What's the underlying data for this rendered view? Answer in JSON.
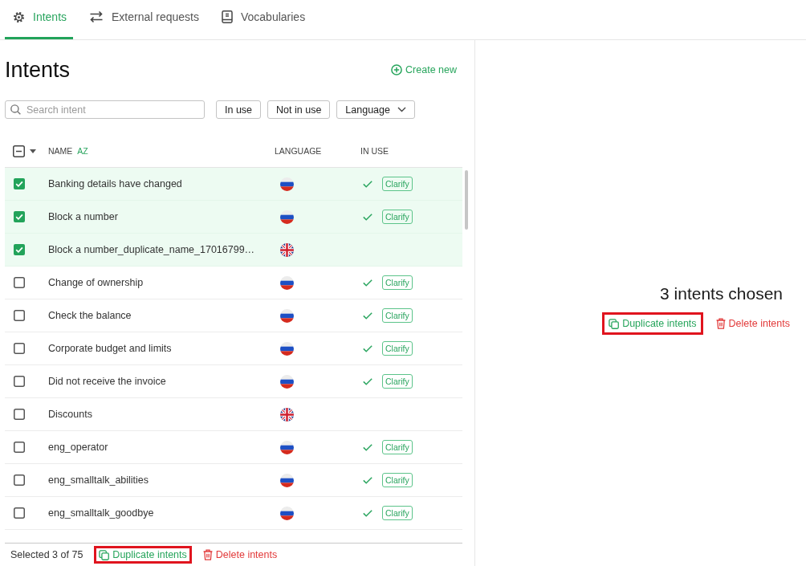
{
  "tabs": [
    {
      "label": "Intents",
      "kind": "gear",
      "selected": true
    },
    {
      "label": "External requests",
      "kind": "swap",
      "selected": false
    },
    {
      "label": "Vocabularies",
      "kind": "book",
      "selected": false
    }
  ],
  "list_panel": {
    "title": "Intents",
    "create_link": "Create new",
    "search": {
      "placeholder": "Search intent"
    },
    "filters": [
      {
        "label": "In use",
        "kind": "toggle"
      },
      {
        "label": "Not in use",
        "kind": "toggle"
      },
      {
        "label": "Language",
        "kind": "dropdown"
      }
    ]
  },
  "table": {
    "select_all": {
      "indeterminate": true
    },
    "columns": [
      {
        "label": "NAME",
        "sort": "AZ"
      },
      {
        "label": "LANGUAGE"
      },
      {
        "label": "IN USE"
      }
    ],
    "rows": [
      {
        "name": "Banking details have changed",
        "checked": true,
        "flag": {
          "kind": "ru"
        },
        "in_use": true,
        "badge": "Clarify"
      },
      {
        "name": "Block a number",
        "checked": true,
        "flag": {
          "kind": "ru"
        },
        "in_use": true,
        "badge": "Clarify"
      },
      {
        "name": "Block a number_duplicate_name_17016799…",
        "checked": true,
        "flag": {
          "kind": "gb"
        },
        "in_use": false
      },
      {
        "name": "Change of ownership",
        "checked": false,
        "flag": {
          "kind": "ru"
        },
        "in_use": true,
        "badge": "Clarify"
      },
      {
        "name": "Check the balance",
        "checked": false,
        "flag": {
          "kind": "ru"
        },
        "in_use": true,
        "badge": "Clarify"
      },
      {
        "name": "Corporate budget and limits",
        "checked": false,
        "flag": {
          "kind": "ru"
        },
        "in_use": true,
        "badge": "Clarify"
      },
      {
        "name": "Did not receive the invoice",
        "checked": false,
        "flag": {
          "kind": "ru"
        },
        "in_use": true,
        "badge": "Clarify"
      },
      {
        "name": "Discounts",
        "checked": false,
        "flag": {
          "kind": "gb"
        },
        "in_use": false
      },
      {
        "name": "eng_operator",
        "checked": false,
        "flag": {
          "kind": "ru"
        },
        "in_use": true,
        "badge": "Clarify"
      },
      {
        "name": "eng_smalltalk_abilities",
        "checked": false,
        "flag": {
          "kind": "ru"
        },
        "in_use": true,
        "badge": "Clarify"
      },
      {
        "name": "eng_smalltalk_goodbye",
        "checked": false,
        "flag": {
          "kind": "ru"
        },
        "in_use": true,
        "badge": "Clarify"
      }
    ]
  },
  "footer": {
    "selection": "Selected 3 of 75",
    "actions": [
      {
        "label": "Duplicate intents",
        "kind": "duplicate",
        "highlighted": true
      },
      {
        "label": "Delete intents",
        "kind": "delete",
        "highlighted": false
      }
    ]
  },
  "detail_panel": {
    "title": "3 intents chosen",
    "actions": [
      {
        "label": "Duplicate intents",
        "kind": "duplicate",
        "highlighted": true
      },
      {
        "label": "Delete intents",
        "kind": "delete",
        "highlighted": false
      }
    ]
  }
}
